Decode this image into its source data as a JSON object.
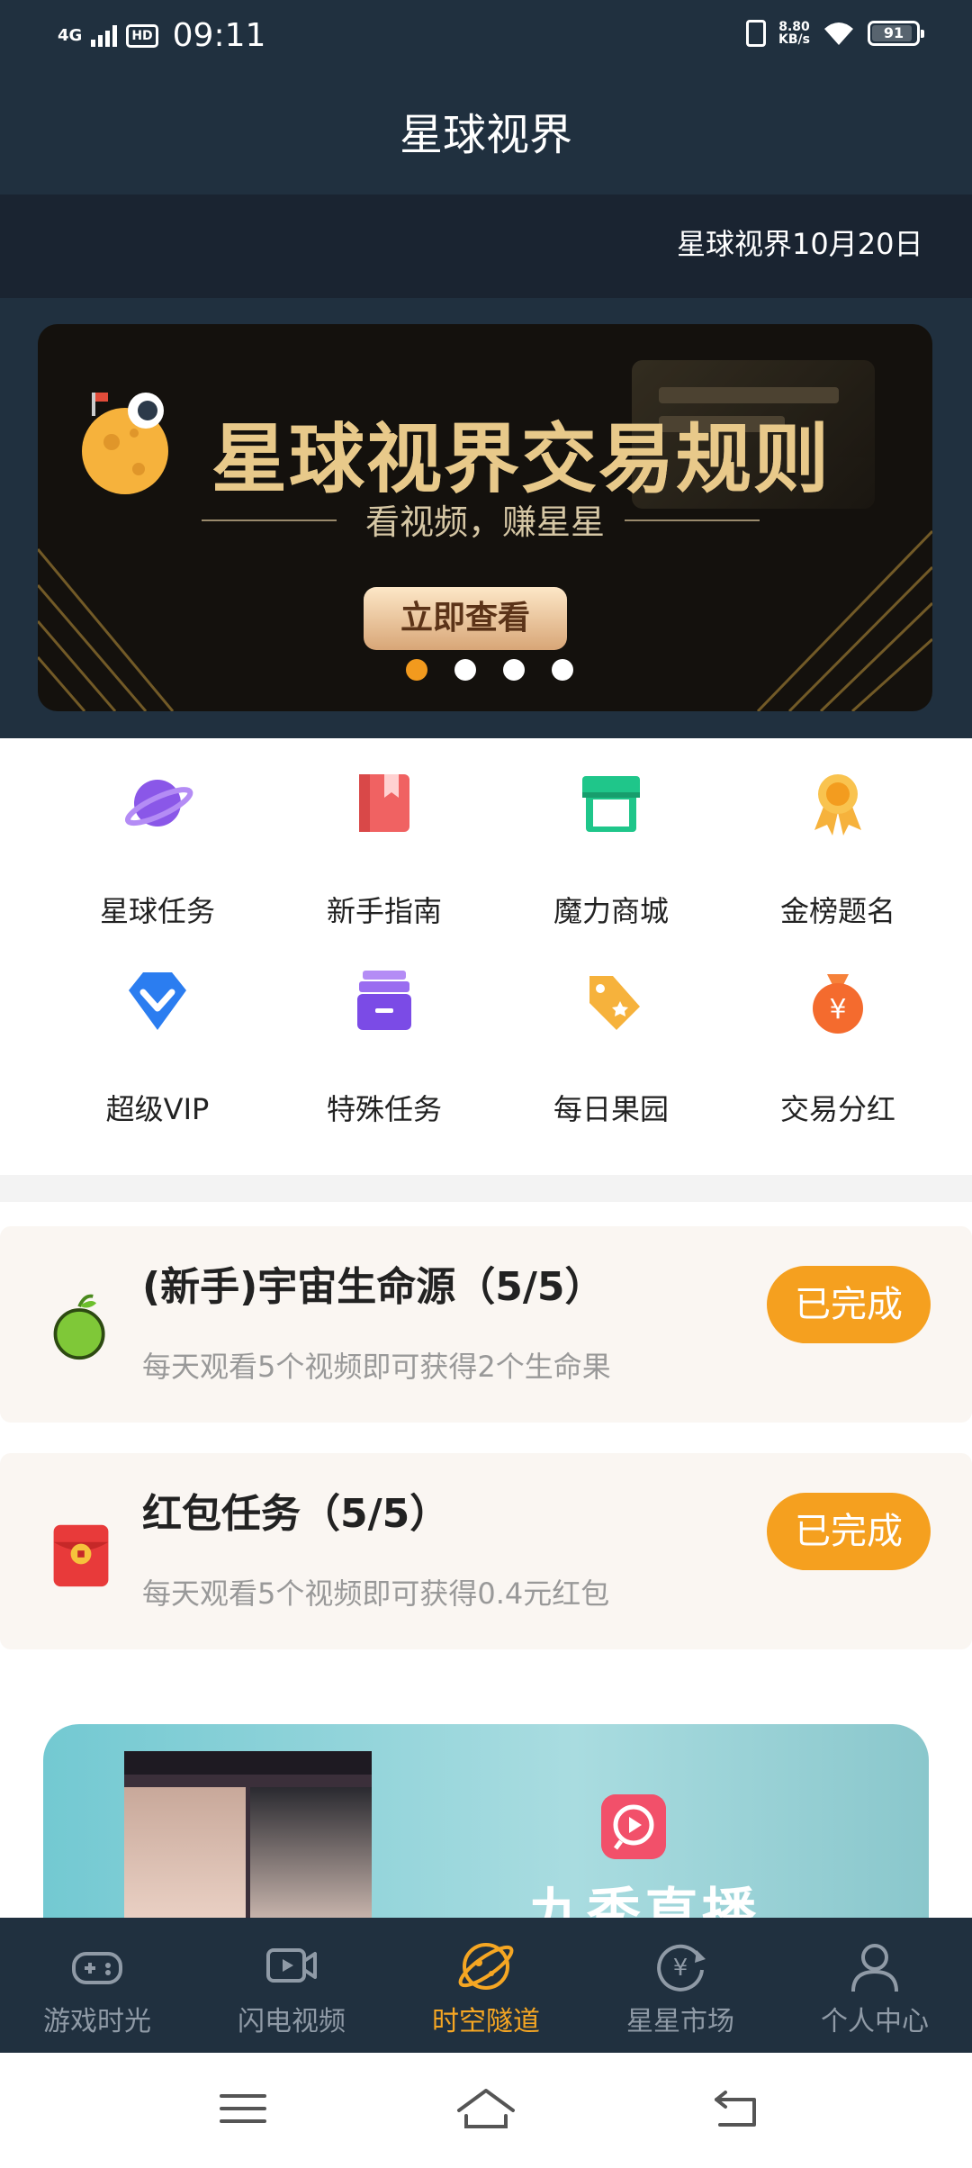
{
  "status": {
    "network": "4G",
    "hd": "HD",
    "time": "09:11",
    "speed_value": "8.80",
    "speed_unit": "KB/s",
    "battery": "91",
    "battery_level": 0.91
  },
  "header": {
    "title": "星球视界"
  },
  "marquee": {
    "text": "星球视界10月20日"
  },
  "banner": {
    "title": "星球视界交易规则",
    "subtitle": "看视频，赚星星",
    "button": "立即查看",
    "dot_count": 4,
    "active_dot": 0
  },
  "grid": [
    {
      "label": "星球任务",
      "icon": "planet-icon"
    },
    {
      "label": "新手指南",
      "icon": "book-icon"
    },
    {
      "label": "魔力商城",
      "icon": "shop-icon"
    },
    {
      "label": "金榜题名",
      "icon": "medal-icon"
    },
    {
      "label": "超级VIP",
      "icon": "diamond-icon"
    },
    {
      "label": "特殊任务",
      "icon": "box-icon"
    },
    {
      "label": "每日果园",
      "icon": "tag-icon"
    },
    {
      "label": "交易分红",
      "icon": "money-bag-icon"
    }
  ],
  "tasks": [
    {
      "title": "(新手)宇宙生命源（5/5）",
      "desc": "每天观看5个视频即可获得2个生命果",
      "button": "已完成",
      "icon": "apple-icon"
    },
    {
      "title": "红包任务（5/5）",
      "desc": "每天观看5个视频即可获得0.4元红包",
      "button": "已完成",
      "icon": "red-envelope-icon"
    }
  ],
  "live_banner": {
    "name": "九秀直播"
  },
  "tabs": [
    {
      "label": "游戏时光",
      "icon": "gamepad-icon",
      "active": false
    },
    {
      "label": "闪电视频",
      "icon": "video-icon",
      "active": false
    },
    {
      "label": "时空隧道",
      "icon": "tunnel-icon",
      "active": true
    },
    {
      "label": "星星市场",
      "icon": "yuan-exchange-icon",
      "active": false
    },
    {
      "label": "个人中心",
      "icon": "person-icon",
      "active": false
    }
  ],
  "colors": {
    "accent": "#f5a01f",
    "header_bg": "#20303f",
    "tab_active": "#f5a623"
  }
}
